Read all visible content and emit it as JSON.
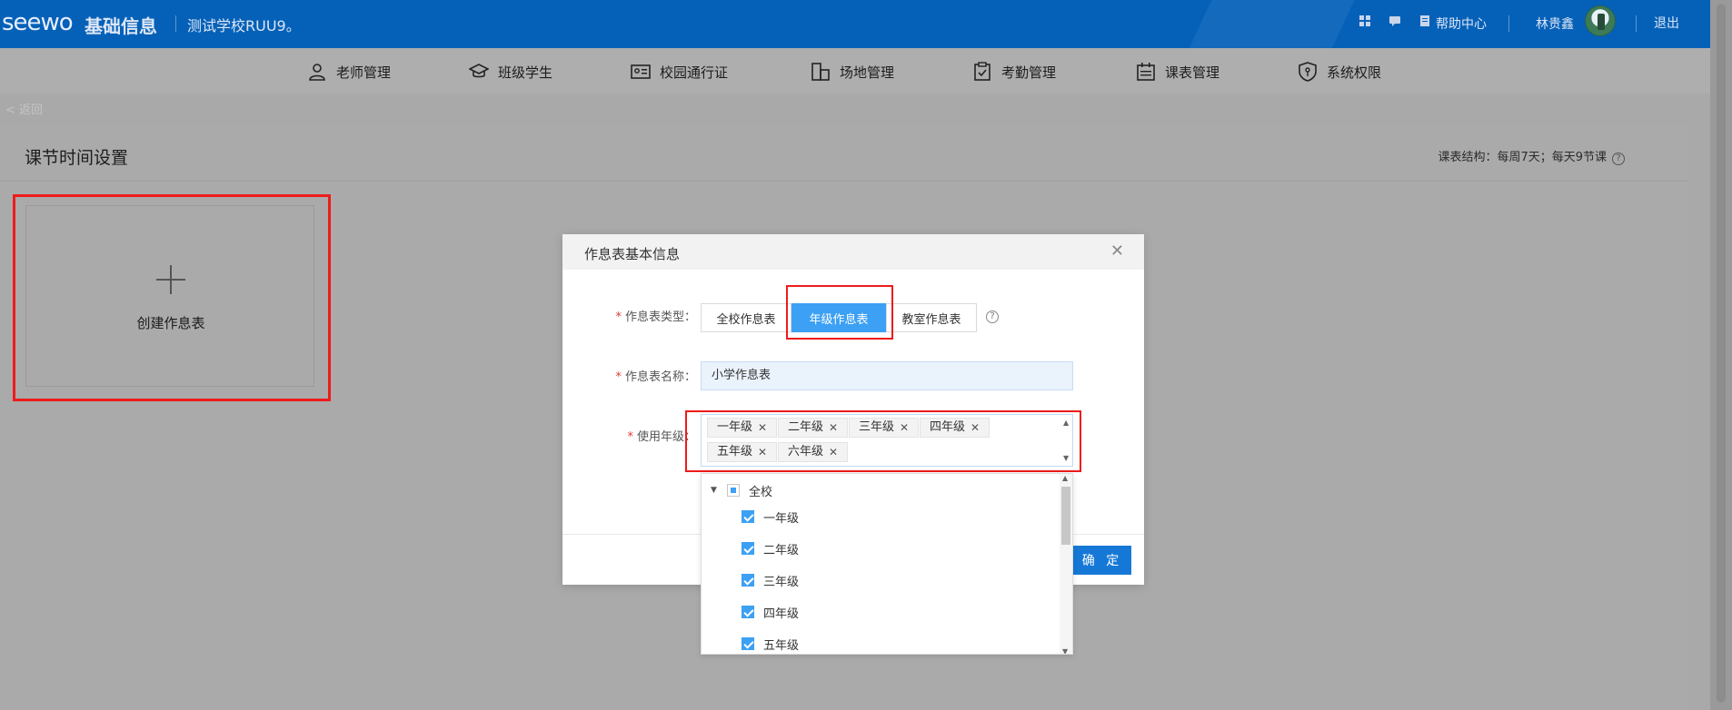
{
  "header": {
    "logo": "seewo",
    "app_name": "基础信息",
    "school": "测试学校RUU9。",
    "help": "帮助中心",
    "user": "林贵鑫",
    "logout": "退出"
  },
  "nav": {
    "items": [
      {
        "label": "老师管理",
        "icon": "user-icon"
      },
      {
        "label": "班级学生",
        "icon": "graduation-cap-icon"
      },
      {
        "label": "校园通行证",
        "icon": "id-card-icon"
      },
      {
        "label": "场地管理",
        "icon": "building-icon"
      },
      {
        "label": "考勤管理",
        "icon": "clipboard-check-icon"
      },
      {
        "label": "课表管理",
        "icon": "calendar-icon"
      },
      {
        "label": "系统权限",
        "icon": "shield-icon"
      }
    ]
  },
  "back_link": "< 返回",
  "page": {
    "title": "课节时间设置",
    "structure": "课表结构：每周7天；每天9节课",
    "create_label": "创建作息表"
  },
  "modal": {
    "title": "作息表基本信息",
    "type_label": "作息表类型：",
    "type_options": [
      "全校作息表",
      "年级作息表",
      "教室作息表"
    ],
    "type_selected": "年级作息表",
    "name_label": "作息表名称：",
    "name_value": "小学作息表",
    "grade_label": "使用年级：",
    "grade_tags": [
      "一年级",
      "二年级",
      "三年级",
      "四年级",
      "五年级",
      "六年级"
    ],
    "confirm": "确 定"
  },
  "dropdown": {
    "root": "全校",
    "items": [
      "一年级",
      "二年级",
      "三年级",
      "四年级",
      "五年级"
    ]
  }
}
